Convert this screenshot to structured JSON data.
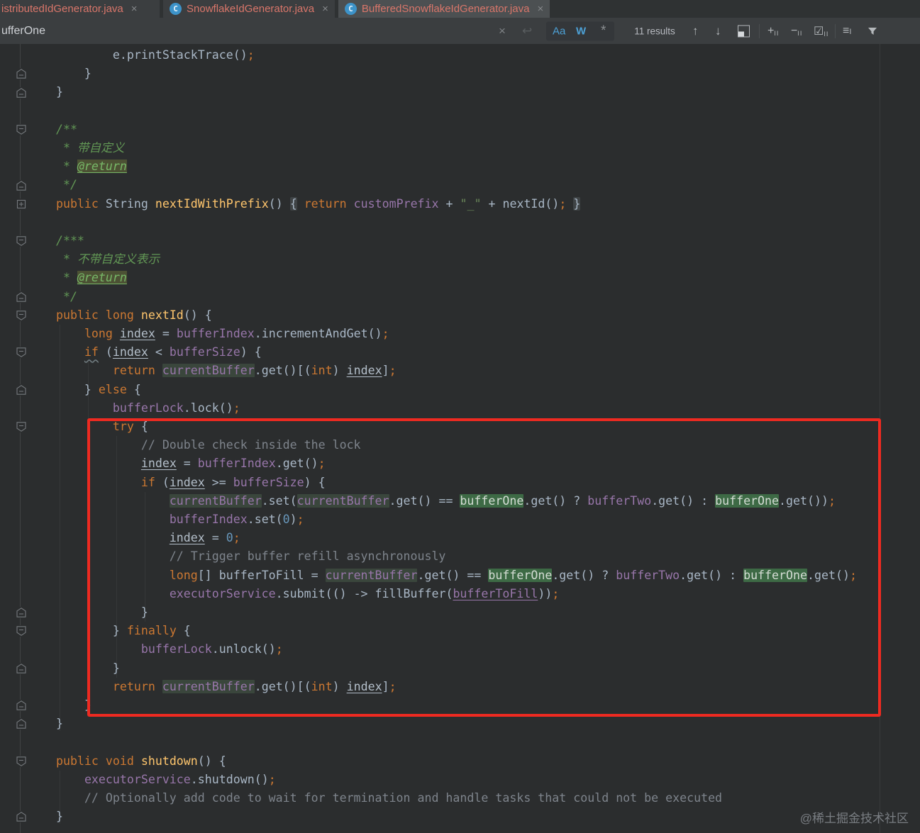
{
  "tabs": [
    {
      "label": "istributedIdGenerator.java",
      "active": false
    },
    {
      "label": "SnowflakeIdGenerator.java",
      "active": false
    },
    {
      "label": "BufferedSnowflakeIdGenerator.java",
      "active": true
    }
  ],
  "find": {
    "query": "ufferOne",
    "results": "11 results"
  },
  "icons": {
    "close": "×",
    "class_glyph": "C",
    "reset": "↩",
    "match_case": "Aa",
    "words": "W",
    "regex": "*",
    "prev": "↑",
    "next": "↓",
    "plus": "+",
    "minus": "−",
    "check": "☑",
    "sub_bars": "II",
    "lines": "≡",
    "lines_sub": "I"
  },
  "palette": {
    "annotation_red": "#EE2A21",
    "accent_blue": "#4DA1D6",
    "match_green": "#3D6A45",
    "tab_text": "#D9766A"
  },
  "watermark": {
    "text": "@稀土掘金技术社区"
  },
  "editor": {
    "lines": [
      [
        [
          "",
          "            e.printStackTrace()"
        ],
        [
          "semi",
          ";"
        ]
      ],
      [
        [
          "",
          "        }"
        ]
      ],
      [
        [
          "",
          "    }"
        ]
      ],
      [],
      [
        [
          "doc",
          "    /**"
        ]
      ],
      [
        [
          "doc",
          "     * 带自定义"
        ]
      ],
      [
        [
          "doc",
          "     * "
        ],
        [
          "doctag",
          "@return"
        ]
      ],
      [
        [
          "doc",
          "     */"
        ]
      ],
      [
        [
          "kw",
          "    public"
        ],
        [
          "",
          "一String "
        ],
        [
          "mth",
          "nextIdWithPrefix"
        ],
        [
          "",
          "() "
        ],
        [
          "fbg",
          "{"
        ],
        [
          "",
          "一"
        ],
        [
          "kw",
          "return"
        ],
        [
          "",
          "一"
        ],
        [
          "fld",
          "customPrefix"
        ],
        [
          "",
          "一+ "
        ],
        [
          "str",
          "\"_\""
        ],
        [
          "",
          "一+ nextId()"
        ],
        [
          "semi",
          ";"
        ],
        [
          "",
          "一"
        ],
        [
          "fbg",
          "}"
        ]
      ],
      [],
      [
        [
          "doc",
          "    /***"
        ]
      ],
      [
        [
          "doc",
          "     * 不带自定义表示"
        ]
      ],
      [
        [
          "doc",
          "     * "
        ],
        [
          "doctag",
          "@return"
        ]
      ],
      [
        [
          "doc",
          "     */"
        ]
      ],
      [
        [
          "kw",
          "    public long"
        ],
        [
          "",
          "一"
        ],
        [
          "mth",
          "nextId"
        ],
        [
          "",
          "() {"
        ]
      ],
      [
        [
          "",
          "        "
        ],
        [
          "kw",
          "long"
        ],
        [
          "",
          "一"
        ],
        [
          "und",
          "index"
        ],
        [
          "",
          "一= "
        ],
        [
          "fld",
          "bufferIndex"
        ],
        [
          "",
          ".incrementAndGet()"
        ],
        [
          "semi",
          ";"
        ]
      ],
      [
        [
          "",
          "        "
        ],
        [
          "kw sq",
          "if"
        ],
        [
          "",
          "一("
        ],
        [
          "und",
          "index"
        ],
        [
          "",
          "一< "
        ],
        [
          "fld",
          "bufferSize"
        ],
        [
          "",
          ") {"
        ]
      ],
      [
        [
          "",
          "            "
        ],
        [
          "kw",
          "return"
        ],
        [
          "",
          "一"
        ],
        [
          "fld hlc",
          "currentBuffer"
        ],
        [
          "",
          ".get()[("
        ],
        [
          "kw",
          "int"
        ],
        [
          "",
          ")一"
        ],
        [
          "und",
          "index"
        ],
        [
          "",
          "]"
        ],
        [
          "semi",
          ";"
        ]
      ],
      [
        [
          "",
          "        } "
        ],
        [
          "kw",
          "else"
        ],
        [
          "",
          "一{"
        ]
      ],
      [
        [
          "",
          "            "
        ],
        [
          "fld",
          "bufferLock"
        ],
        [
          "",
          ".lock()"
        ],
        [
          "semi",
          ";"
        ]
      ],
      [
        [
          "",
          "            "
        ],
        [
          "kw",
          "try"
        ],
        [
          "",
          "一{"
        ]
      ],
      [
        [
          "cmt",
          "                // Double check inside the lock"
        ]
      ],
      [
        [
          "",
          "                "
        ],
        [
          "und",
          "index"
        ],
        [
          "",
          "一= "
        ],
        [
          "fld",
          "bufferIndex"
        ],
        [
          "",
          ".get()"
        ],
        [
          "semi",
          ";"
        ]
      ],
      [
        [
          "",
          "                "
        ],
        [
          "kw",
          "if"
        ],
        [
          "",
          "一("
        ],
        [
          "und",
          "index"
        ],
        [
          "",
          "一>= "
        ],
        [
          "fld",
          "bufferSize"
        ],
        [
          "",
          ") {"
        ]
      ],
      [
        [
          "",
          "                    "
        ],
        [
          "fld hlc",
          "currentBuffer"
        ],
        [
          "",
          ".set("
        ],
        [
          "fld hlc",
          "currentBuffer"
        ],
        [
          "",
          ".get() == "
        ],
        [
          "hlm",
          "bufferOne"
        ],
        [
          "",
          ".get() ? "
        ],
        [
          "fld",
          "bufferTwo"
        ],
        [
          "",
          ".get() : "
        ],
        [
          "hlm",
          "bufferOne"
        ],
        [
          "",
          ".get())"
        ],
        [
          "semi",
          ";"
        ]
      ],
      [
        [
          "",
          "                    "
        ],
        [
          "fld",
          "bufferIndex"
        ],
        [
          "",
          ".set("
        ],
        [
          "num",
          "0"
        ],
        [
          "",
          ")"
        ],
        [
          "semi",
          ";"
        ]
      ],
      [
        [
          "",
          "                    "
        ],
        [
          "und",
          "index"
        ],
        [
          "",
          "一= "
        ],
        [
          "num",
          "0"
        ],
        [
          "semi",
          ";"
        ]
      ],
      [
        [
          "cmt",
          "                    // Trigger buffer refill asynchronously"
        ]
      ],
      [
        [
          "",
          "                    "
        ],
        [
          "kw",
          "long"
        ],
        [
          "",
          "[] bufferToFill = "
        ],
        [
          "fld hlc",
          "currentBuffer"
        ],
        [
          "",
          ".get() == "
        ],
        [
          "hlm",
          "bufferOne"
        ],
        [
          "",
          ".get() ? "
        ],
        [
          "fld",
          "bufferTwo"
        ],
        [
          "",
          ".get() : "
        ],
        [
          "hlm",
          "bufferOne"
        ],
        [
          "",
          ".get()"
        ],
        [
          "semi",
          ";"
        ]
      ],
      [
        [
          "",
          "                    "
        ],
        [
          "fld",
          "executorService"
        ],
        [
          "",
          ".submit(() -> fillBuffer("
        ],
        [
          "lam",
          "bufferToFill"
        ],
        [
          "",
          "))"
        ],
        [
          "semi",
          ";"
        ]
      ],
      [
        [
          "",
          "                }"
        ]
      ],
      [
        [
          "",
          "            } "
        ],
        [
          "kw",
          "finally"
        ],
        [
          "",
          "一{"
        ]
      ],
      [
        [
          "",
          "                "
        ],
        [
          "fld",
          "bufferLock"
        ],
        [
          "",
          ".unlock()"
        ],
        [
          "semi",
          ";"
        ]
      ],
      [
        [
          "",
          "            }"
        ]
      ],
      [
        [
          "",
          "            "
        ],
        [
          "kw",
          "return"
        ],
        [
          "",
          "一"
        ],
        [
          "fld hlc",
          "currentBuffer"
        ],
        [
          "",
          ".get()[("
        ],
        [
          "kw",
          "int"
        ],
        [
          "",
          ")一"
        ],
        [
          "und",
          "index"
        ],
        [
          "",
          "]"
        ],
        [
          "semi",
          ";"
        ]
      ],
      [
        [
          "",
          "        }"
        ]
      ],
      [
        [
          "",
          "    }"
        ]
      ],
      [],
      [
        [
          "kw",
          "    public void"
        ],
        [
          "",
          "一"
        ],
        [
          "mth",
          "shutdown"
        ],
        [
          "",
          "() {"
        ]
      ],
      [
        [
          "",
          "        "
        ],
        [
          "fld",
          "executorService"
        ],
        [
          "",
          ".shutdown()"
        ],
        [
          "semi",
          ";"
        ]
      ],
      [
        [
          "cmt",
          "        // Optionally add code to wait for termination and handle tasks that could not be executed"
        ]
      ],
      [
        [
          "",
          "    }"
        ]
      ]
    ],
    "fold_icons": [
      {
        "line": 1,
        "type": "up"
      },
      {
        "line": 2,
        "type": "up"
      },
      {
        "line": 4,
        "type": "down"
      },
      {
        "line": 7,
        "type": "up"
      },
      {
        "line": 8,
        "type": "plus"
      },
      {
        "line": 10,
        "type": "down"
      },
      {
        "line": 13,
        "type": "up"
      },
      {
        "line": 14,
        "type": "down"
      },
      {
        "line": 16,
        "type": "down"
      },
      {
        "line": 18,
        "type": "up"
      },
      {
        "line": 20,
        "type": "down"
      },
      {
        "line": 30,
        "type": "up"
      },
      {
        "line": 31,
        "type": "down"
      },
      {
        "line": 33,
        "type": "up"
      },
      {
        "line": 35,
        "type": "up"
      },
      {
        "line": 36,
        "type": "up"
      },
      {
        "line": 38,
        "type": "down"
      },
      {
        "line": 41,
        "type": "up"
      }
    ]
  }
}
